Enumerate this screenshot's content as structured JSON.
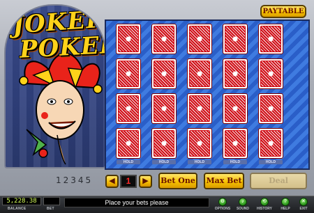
{
  "logo": {
    "line1": "JOKER",
    "line2": "POKER"
  },
  "paytable_label": "PAYTABLE",
  "bet_scale": "12345",
  "cards": {
    "rows": 4,
    "cols": 5,
    "hold_labels": [
      "HOLD",
      "HOLD",
      "HOLD",
      "HOLD",
      "HOLD"
    ]
  },
  "controls": {
    "decrease_label": "◀",
    "increase_label": "▶",
    "bet_value": "1",
    "bet_one_label": "Bet One",
    "max_bet_label": "Max Bet",
    "deal_label": "Deal"
  },
  "status": {
    "balance_value": "5,228.38",
    "balance_label": "BALANCE",
    "bet_value": "",
    "bet_label": "BET",
    "message": "Place your bets please"
  },
  "menu": {
    "options": "OPTIONS",
    "sound": "SOUND",
    "history": "HISTORY",
    "help": "HELP",
    "exit": "EXIT"
  },
  "colors": {
    "button_gold": "#f6c200",
    "card_red": "#d30b14",
    "table_blue": "#2d5fc9",
    "icon_green": "#2f9b1f"
  }
}
